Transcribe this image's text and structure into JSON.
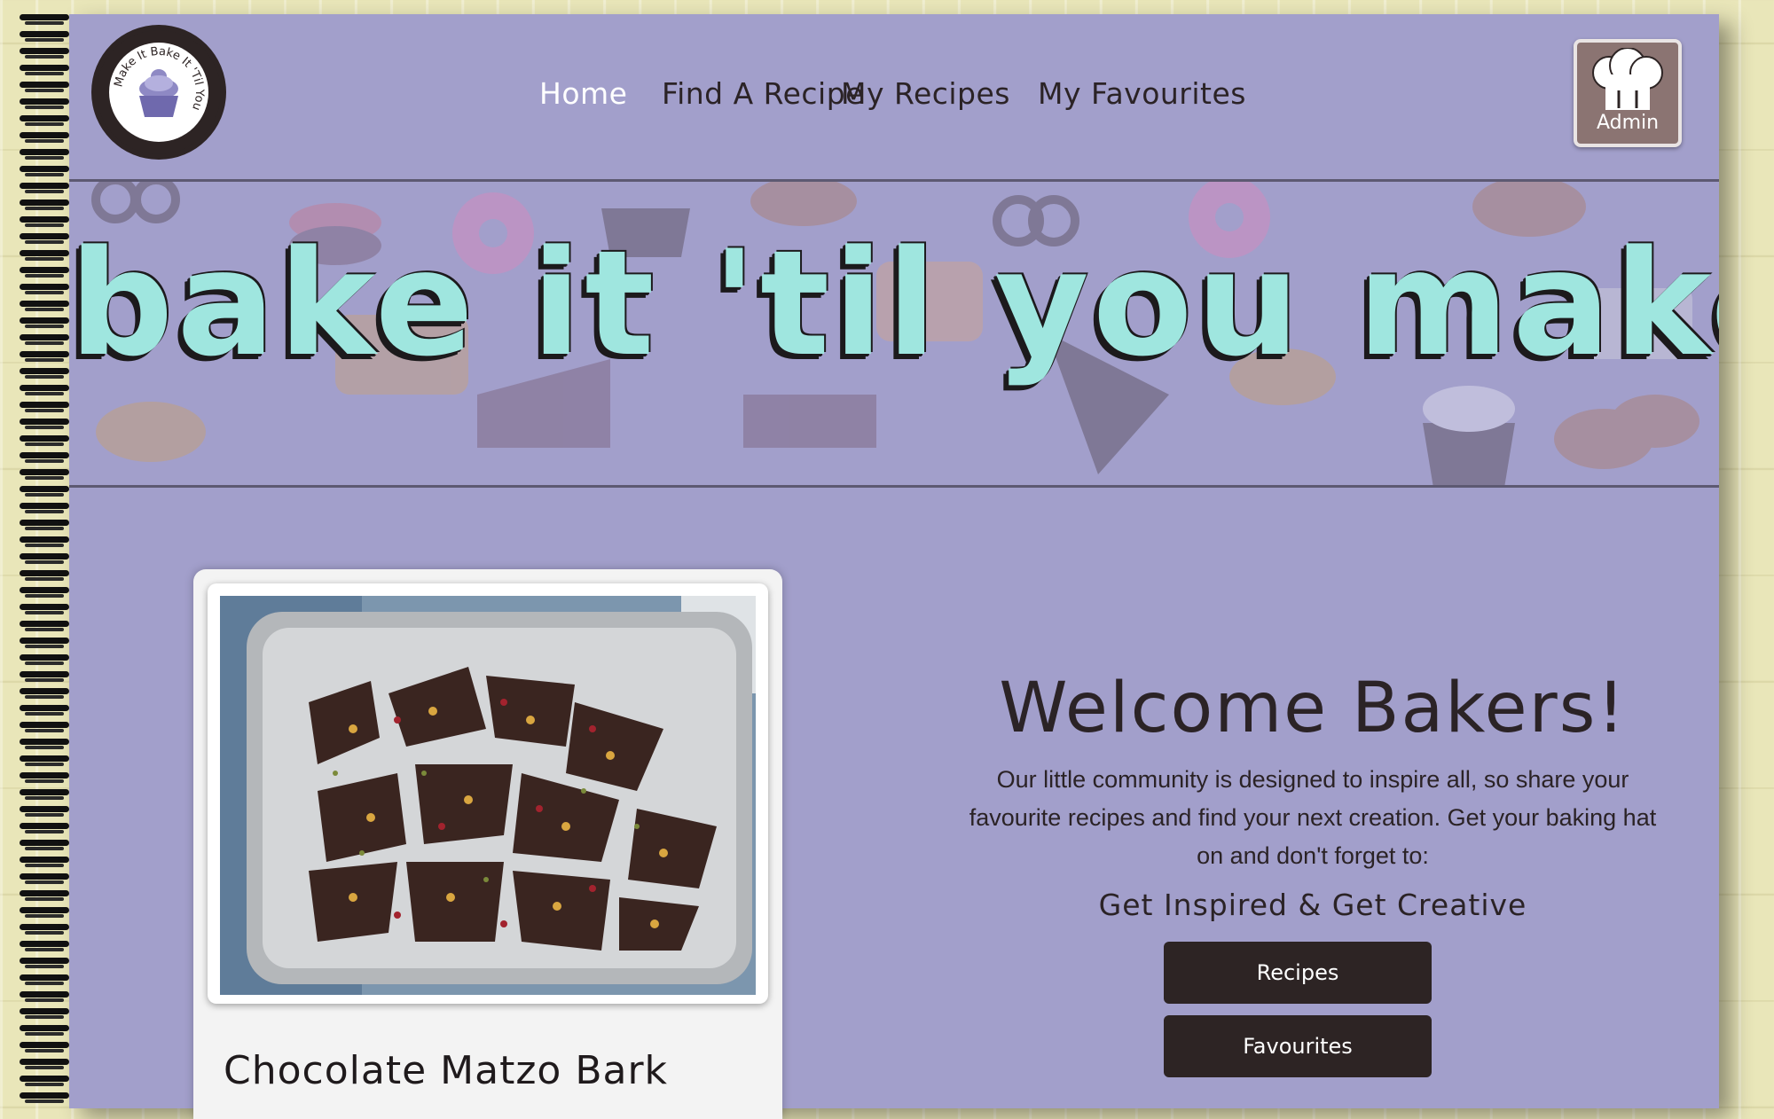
{
  "site": {
    "logo_text": "Make It Bake It 'Til You"
  },
  "nav": {
    "items": [
      {
        "label": "Home",
        "active": true
      },
      {
        "label": "Find A Recipe",
        "active": false
      },
      {
        "label": "My Recipes",
        "active": false
      },
      {
        "label": "My Favourites",
        "active": false
      }
    ]
  },
  "admin": {
    "label": "Admin",
    "icon": "chef-hat-icon"
  },
  "banner": {
    "title": "bake it 'til you make it"
  },
  "featured_recipe": {
    "title": "Chocolate Matzo Bark"
  },
  "welcome": {
    "title": "Welcome Bakers!",
    "body": "Our little community is designed to inspire all, so share your favourite recipes and find your next creation. Get your baking hat on and don't forget to:",
    "tagline": "Get Inspired & Get Creative"
  },
  "buttons": {
    "recipes": "Recipes",
    "favourites": "Favourites"
  },
  "colors": {
    "page_purple": "#a29fcb",
    "dark_brown": "#2d2424",
    "title_mint": "#9fe6df",
    "admin_brown": "#8b7472"
  }
}
